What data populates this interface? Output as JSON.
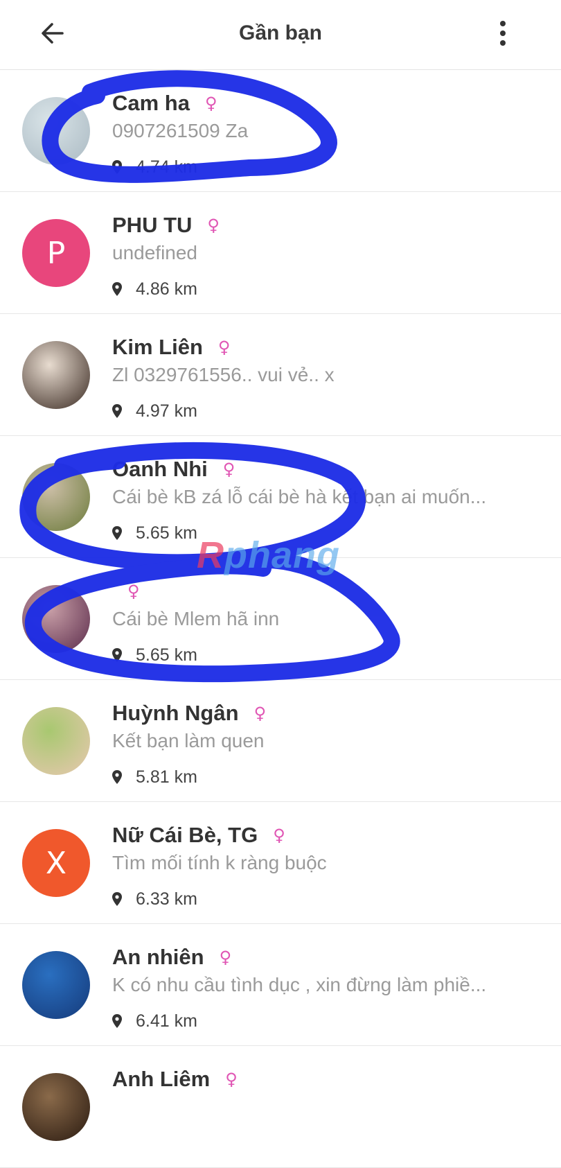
{
  "header": {
    "title": "Gần bạn",
    "back_icon": "arrow-left-icon",
    "more_icon": "more-vertical-icon"
  },
  "colors": {
    "gender_female": "#e056b4",
    "scribble": "#1d2de6",
    "divider": "#e6e6e6"
  },
  "users": [
    {
      "name": "Cam ha",
      "status": "0907261509        Za",
      "distance": "4.74 km",
      "avatar": {
        "type": "photo",
        "colors": [
          "#d9e4e8",
          "#aab9c2"
        ]
      }
    },
    {
      "name": "PHU TU",
      "status": "undefined",
      "distance": "4.86 km",
      "avatar": {
        "type": "letter",
        "letter": "P",
        "color": "#e8467c"
      }
    },
    {
      "name": "Kim Liên",
      "status": "Zl 0329761556.. vui vẻ.. x",
      "distance": "4.97 km",
      "avatar": {
        "type": "photo",
        "colors": [
          "#e8dcd0",
          "#3a2a22"
        ]
      }
    },
    {
      "name": "Oanh Nhi",
      "status": "Cái bè kB zá lỗ cái bè hà kết bạn  ai muốn...",
      "distance": "5.65 km",
      "avatar": {
        "type": "photo",
        "colors": [
          "#cdbfa8",
          "#6b7a3a"
        ]
      }
    },
    {
      "name": "",
      "status": "Cái bè Mlem hã inn",
      "distance": "5.65 km",
      "avatar": {
        "type": "photo",
        "colors": [
          "#c9a0a8",
          "#5a2a4a"
        ]
      }
    },
    {
      "name": "Huỳnh Ngân",
      "status": "Kết bạn làm quen",
      "distance": "5.81 km",
      "avatar": {
        "type": "photo",
        "colors": [
          "#a8c870",
          "#e8c8b0"
        ]
      }
    },
    {
      "name": "Nữ Cái Bè, TG",
      "status": "Tìm mối tính k ràng buộc",
      "distance": "6.33 km",
      "avatar": {
        "type": "letter",
        "letter": "X",
        "color": "#f0582c"
      }
    },
    {
      "name": "An nhiên",
      "status": "K có nhu cầu tình dục , xin đừng làm phiề...",
      "distance": "6.41 km",
      "avatar": {
        "type": "photo",
        "colors": [
          "#2a6fc0",
          "#153a7a"
        ]
      }
    },
    {
      "name": "Anh Liêm",
      "status": "",
      "distance": "",
      "avatar": {
        "type": "photo",
        "colors": [
          "#8a6a4a",
          "#2a1a10"
        ]
      }
    }
  ],
  "watermark": {
    "text": "Rphang"
  }
}
